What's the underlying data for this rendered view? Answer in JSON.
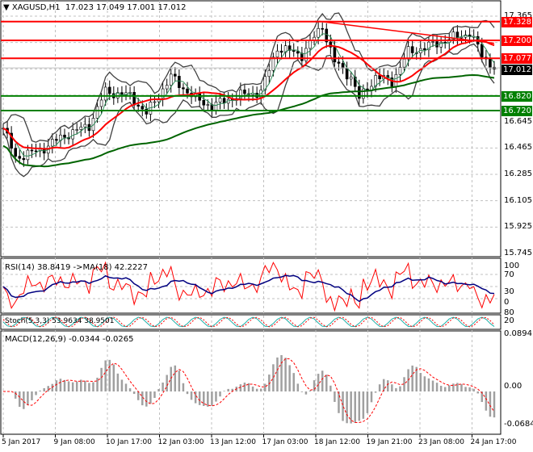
{
  "header": {
    "symbol": "XAGUSD,H1",
    "ohlc": "17.023 17.049 17.001 17.012"
  },
  "price_axis": [
    "17.365",
    "16.645",
    "16.465",
    "16.285",
    "16.105",
    "15.925",
    "15.745"
  ],
  "levels": [
    {
      "value": "17.328",
      "color": "#ff0000"
    },
    {
      "value": "17.200",
      "color": "#ff0000"
    },
    {
      "value": "17.077",
      "color": "#ff0000"
    },
    {
      "value": "16.820",
      "color": "#008000"
    },
    {
      "value": "16.720",
      "color": "#008000"
    }
  ],
  "current_price": "17.012",
  "rsi": {
    "label": "RSI(14) 38.8419  ->MA(18) 42.2227",
    "axis": [
      "100",
      "70",
      "30",
      "0"
    ]
  },
  "stoch": {
    "label": "Stoch(5,3,3) 53.9634 38.9501",
    "axis": [
      "80",
      "20"
    ]
  },
  "macd": {
    "label": "MACD(12,26,9) -0.0344 -0.0265",
    "axis": [
      "0.0894",
      "0.00",
      "-0.0684"
    ]
  },
  "time_axis": [
    "5 Jan 2017",
    "9 Jan 08:00",
    "10 Jan 17:00",
    "12 Jan 03:00",
    "13 Jan 12:00",
    "17 Jan 03:00",
    "18 Jan 12:00",
    "19 Jan 21:00",
    "23 Jan 08:00",
    "24 Jan 17:00"
  ],
  "chart_data": {
    "type": "line",
    "title": "XAGUSD,H1",
    "ylim": [
      15.745,
      17.365
    ],
    "price_path": [
      [
        0,
        16.6
      ],
      [
        3,
        16.4
      ],
      [
        9,
        16.45
      ],
      [
        15,
        16.55
      ],
      [
        21,
        16.62
      ],
      [
        25,
        16.85
      ],
      [
        31,
        16.82
      ],
      [
        35,
        16.7
      ],
      [
        41,
        16.95
      ],
      [
        47,
        16.8
      ],
      [
        51,
        16.75
      ],
      [
        57,
        16.82
      ],
      [
        63,
        16.85
      ],
      [
        67,
        17.15
      ],
      [
        73,
        17.1
      ],
      [
        78,
        17.3
      ],
      [
        81,
        17.05
      ],
      [
        85,
        16.95
      ],
      [
        87,
        16.8
      ],
      [
        91,
        16.95
      ],
      [
        95,
        16.92
      ],
      [
        99,
        17.12
      ],
      [
        103,
        17.15
      ],
      [
        108,
        17.2
      ],
      [
        114,
        17.25
      ],
      [
        117,
        17.1
      ],
      [
        120,
        17.012
      ]
    ],
    "colors": {
      "ma_fast": "#ff0000",
      "ma_slow": "#006400",
      "bands": "#404040"
    }
  }
}
